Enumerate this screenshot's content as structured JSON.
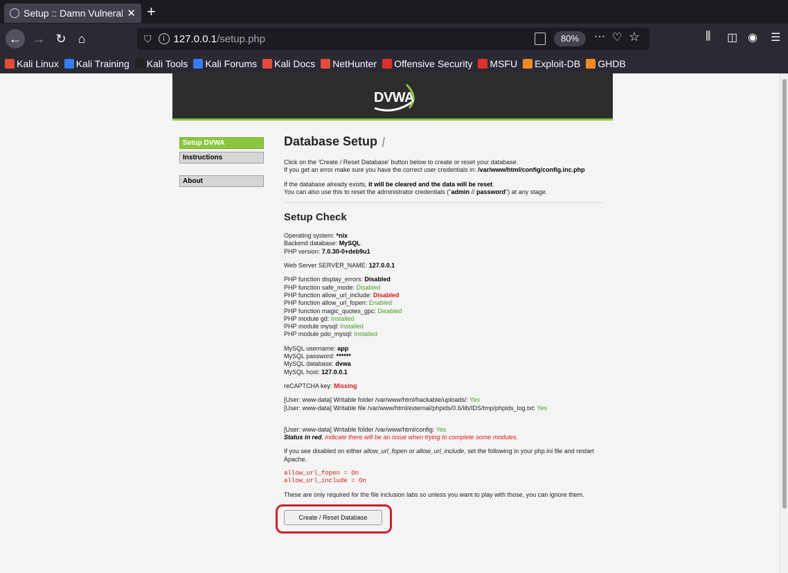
{
  "browser": {
    "tab_title": "Setup :: Damn Vulnerable",
    "url_host": "127.0.0.1",
    "url_path": "/setup.php",
    "zoom": "80%",
    "bookmarks": [
      {
        "label": "Kali Linux",
        "color": "#e34b3c"
      },
      {
        "label": "Kali Training",
        "color": "#367bf0"
      },
      {
        "label": "Kali Tools",
        "color": "#222222"
      },
      {
        "label": "Kali Forums",
        "color": "#367bf0"
      },
      {
        "label": "Kali Docs",
        "color": "#e34b3c"
      },
      {
        "label": "NetHunter",
        "color": "#e34b3c"
      },
      {
        "label": "Offensive Security",
        "color": "#e0302a"
      },
      {
        "label": "MSFU",
        "color": "#e0302a"
      },
      {
        "label": "Exploit-DB",
        "color": "#f08a24"
      },
      {
        "label": "GHDB",
        "color": "#f08a24"
      }
    ]
  },
  "dvwa": {
    "logo": "DVWA",
    "menu": [
      {
        "label": "Setup DVWA",
        "selected": true
      },
      {
        "label": "Instructions",
        "selected": false
      },
      {
        "label": "About",
        "selected": false
      }
    ],
    "title": "Database Setup",
    "intro1": "Click on the 'Create / Reset Database' button below to create or reset your database.",
    "intro2_pre": "If you get an error make sure you have the correct user credentials in: ",
    "intro2_path": "/var/www/html/config/config.inc.php",
    "intro3_pre": "If the database already exists, ",
    "intro3_bold": "it will be cleared and the data will be reset",
    "intro3_post": ".",
    "intro4_pre": "You can also use this to reset the administrator credentials (\"",
    "intro4_user": "admin",
    "intro4_mid": " // ",
    "intro4_pass": "password",
    "intro4_post": "\") at any stage.",
    "setup_check_title": "Setup Check",
    "os_label": "Operating system: ",
    "os_value": "*nix",
    "db_label": "Backend database: ",
    "db_value": "MySQL",
    "php_label": "PHP version: ",
    "php_value": "7.0.30-0+deb9u1",
    "server_label": "Web Server SERVER_NAME: ",
    "server_value": "127.0.0.1",
    "php_checks": [
      {
        "label": "PHP function display_errors: ",
        "value": "Disabled",
        "style": "bold"
      },
      {
        "label": "PHP function safe_mode: ",
        "value": "Disabled",
        "style": "green"
      },
      {
        "label": "PHP function allow_url_include: ",
        "value": "Disabled",
        "style": "red"
      },
      {
        "label": "PHP function allow_url_fopen: ",
        "value": "Enabled",
        "style": "green"
      },
      {
        "label": "PHP function magic_quotes_gpc: ",
        "value": "Disabled",
        "style": "green"
      },
      {
        "label": "PHP module gd: ",
        "value": "Installed",
        "style": "green"
      },
      {
        "label": "PHP module mysql: ",
        "value": "Installed",
        "style": "green"
      },
      {
        "label": "PHP module pdo_mysql: ",
        "value": "Installed",
        "style": "green"
      }
    ],
    "mysql_user_label": "MySQL username: ",
    "mysql_user": "app",
    "mysql_pass_label": "MySQL password: ",
    "mysql_pass": "******",
    "mysql_db_label": "MySQL database: ",
    "mysql_db": "dvwa",
    "mysql_host_label": "MySQL host: ",
    "mysql_host": "127.0.0.1",
    "recaptcha_label": "reCAPTCHA key: ",
    "recaptcha_value": "Missing",
    "writable1_label": "[User: www-data] Writable folder /var/www/html/hackable/uploads/: ",
    "writable1_value": "Yes",
    "writable2_label": "[User: www-data] Writable file /var/www/html/external/phpids/0.6/lib/IDS/tmp/phpids_log.txt: ",
    "writable2_value": "Yes",
    "writable3_label": "[User: www-data] Writable folder /var/www/html/config: ",
    "writable3_value": "Yes",
    "status_red_bold": "Status in red",
    "status_red_rest": ", indicate there will be an issue when trying to complete some modules.",
    "disabled_note_1": "If you see disabled on either ",
    "disabled_note_fopen": "allow_url_fopen",
    "disabled_note_or": " or ",
    "disabled_note_include": "allow_url_include",
    "disabled_note_2": ", set the following in your php.ini file and restart Apache.",
    "code_line1": "allow_url_fopen = On",
    "code_line2": "allow_url_include = On",
    "footer_note": "These are only required for the file inclusion labs so unless you want to play with those, you can ignore them.",
    "button_label": "Create / Reset Database"
  }
}
